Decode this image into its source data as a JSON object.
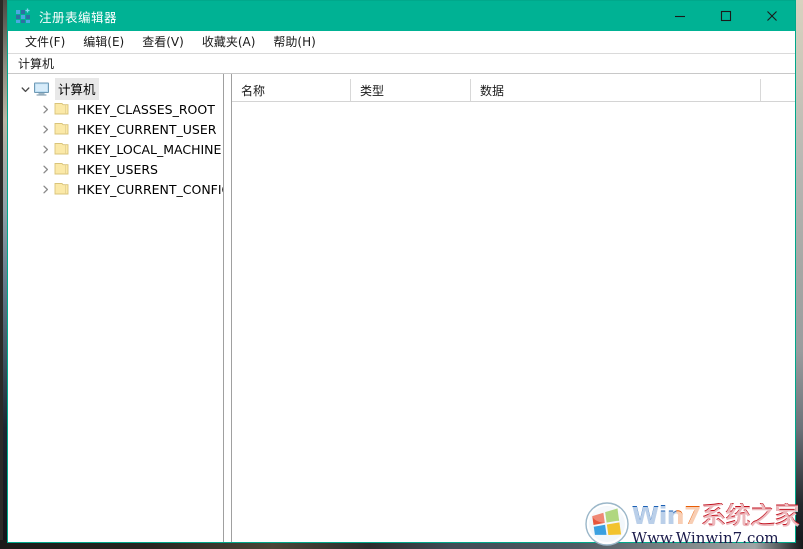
{
  "window": {
    "title": "注册表编辑器",
    "app_icon": "registry-grid-icon",
    "titlebar_color": "#00b294",
    "controls": {
      "minimize": "最小化",
      "maximize": "最大化",
      "close": "关闭"
    }
  },
  "menubar": {
    "items": [
      {
        "label": "文件(F)"
      },
      {
        "label": "编辑(E)"
      },
      {
        "label": "查看(V)"
      },
      {
        "label": "收藏夹(A)"
      },
      {
        "label": "帮助(H)"
      }
    ]
  },
  "addressbar": {
    "value": "计算机"
  },
  "tree": {
    "root": {
      "label": "计算机",
      "icon": "computer-monitor-icon",
      "expanded": true,
      "selected": true
    },
    "children": [
      {
        "label": "HKEY_CLASSES_ROOT",
        "icon": "folder-icon",
        "expanded": false
      },
      {
        "label": "HKEY_CURRENT_USER",
        "icon": "folder-icon",
        "expanded": false
      },
      {
        "label": "HKEY_LOCAL_MACHINE",
        "icon": "folder-icon",
        "expanded": false
      },
      {
        "label": "HKEY_USERS",
        "icon": "folder-icon",
        "expanded": false
      },
      {
        "label": "HKEY_CURRENT_CONFIG",
        "icon": "folder-icon",
        "expanded": false
      }
    ]
  },
  "list": {
    "columns": [
      {
        "label": "名称"
      },
      {
        "label": "类型"
      },
      {
        "label": "数据"
      }
    ],
    "rows": []
  },
  "watermark": {
    "title": "Win7系统之家",
    "url": "Www.Winwin7.com",
    "logo": "windows-orb-icon"
  }
}
